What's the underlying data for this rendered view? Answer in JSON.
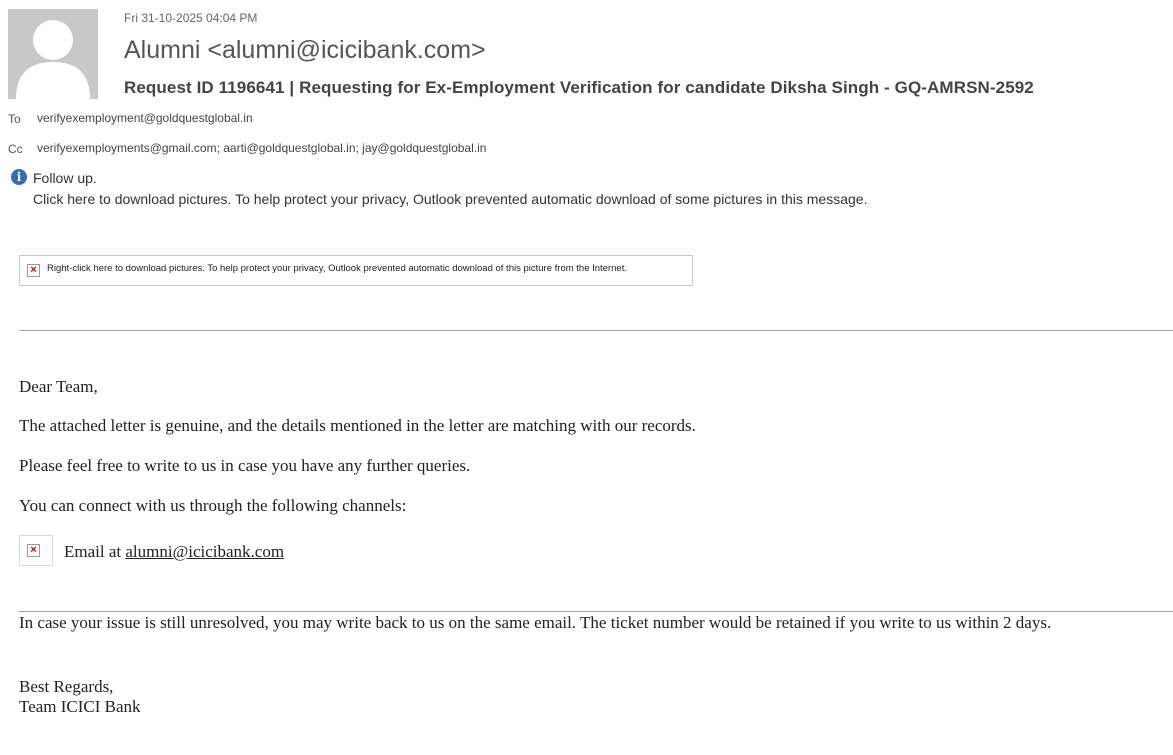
{
  "header": {
    "date": "Fri 31-10-2025 04:04 PM",
    "sender": "Alumni <alumni@icicibank.com>",
    "subject": "Request ID 1196641  | Requesting for Ex-Employment Verification for candidate Diksha Singh - GQ-AMRSN-2592",
    "to_label": "To",
    "to_value": "verifyexemployment@goldquestglobal.in",
    "cc_label": "Cc",
    "cc_value": "verifyexemployments@gmail.com; aarti@goldquestglobal.in; jay@goldquestglobal.in"
  },
  "infobar": {
    "icon": "info-icon",
    "followup": "Follow up.",
    "download_note": "Click here to download pictures. To help protect your privacy, Outlook prevented automatic download of some pictures in this message."
  },
  "blocked_image": {
    "icon": "broken-image-icon",
    "text": "Right-click here to download pictures.  To help protect your privacy, Outlook prevented automatic download of this picture from the Internet."
  },
  "body": {
    "greeting": "Dear Team,",
    "line1": "The attached letter is genuine, and the details mentioned in the letter are matching with our records.",
    "line2": "Please feel free to write to us in case you have any further queries.",
    "line3": "You can connect with us through the following channels:",
    "channel_prefix": "Email at ",
    "channel_link": "alumni@icicibank.com",
    "unresolved": "In case your issue is still unresolved, you may write back to us on the same email. The ticket number would be retained if you write to us within 2 days.",
    "regards": "Best Regards,",
    "signature": "Team ICICI Bank"
  },
  "colors": {
    "info_blue": "#2f6fb7",
    "broken_x_red": "#d00000"
  }
}
